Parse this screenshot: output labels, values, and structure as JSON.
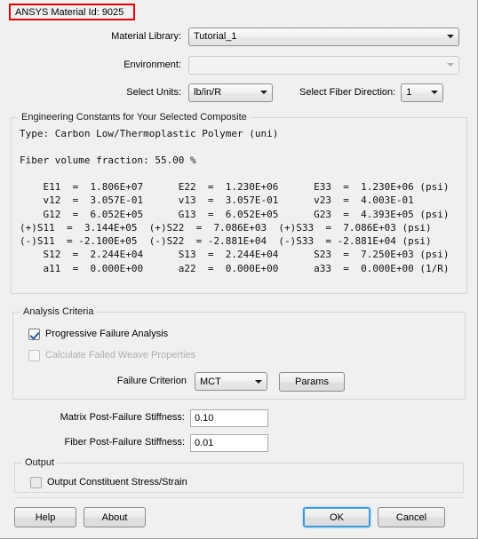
{
  "dialog": {
    "material_id_label": "ANSYS Material Id: 9025",
    "highlight_color": "#e50000"
  },
  "form": {
    "material_library": {
      "label": "Material Library:",
      "value": "Tutorial_1"
    },
    "environment": {
      "label": "Environment:",
      "value": ""
    },
    "select_units": {
      "label": "Select Units:",
      "value": "lb/in/R"
    },
    "select_fiber_direction": {
      "label": "Select Fiber Direction:",
      "value": "1"
    }
  },
  "engineering_constants": {
    "title": "Engineering Constants for Your Selected Composite",
    "type_line": "Type: Carbon Low/Thermoplastic Polymer (uni)",
    "fiber_volume_line": "Fiber volume fraction: 55.00 %",
    "table_text": "    E11  =  1.806E+07      E22  =  1.230E+06      E33  =  1.230E+06 (psi)\n    v12  =  3.057E-01      v13  =  3.057E-01      v23  =  4.003E-01\n    G12  =  6.052E+05      G13  =  6.052E+05      G23  =  4.393E+05 (psi)\n(+)S11  =  3.144E+05  (+)S22  =  7.086E+03  (+)S33  =  7.086E+03 (psi)\n(-)S11  = -2.100E+05  (-)S22  = -2.881E+04  (-)S33  = -2.881E+04 (psi)\n    S12  =  2.244E+04      S13  =  2.244E+04      S23  =  7.250E+03 (psi)\n    a11  =  0.000E+00      a22  =  0.000E+00      a33  =  0.000E+00 (1/R)",
    "rows": [
      {
        "c1_name": "E11",
        "c1_value": "1.806E+07",
        "c2_name": "E22",
        "c2_value": "1.230E+06",
        "c3_name": "E33",
        "c3_value": "1.230E+06",
        "units": "(psi)"
      },
      {
        "c1_name": "v12",
        "c1_value": "3.057E-01",
        "c2_name": "v13",
        "c2_value": "3.057E-01",
        "c3_name": "v23",
        "c3_value": "4.003E-01",
        "units": ""
      },
      {
        "c1_name": "G12",
        "c1_value": "6.052E+05",
        "c2_name": "G13",
        "c2_value": "6.052E+05",
        "c3_name": "G23",
        "c3_value": "4.393E+05",
        "units": "(psi)"
      },
      {
        "c1_name": "(+)S11",
        "c1_value": "3.144E+05",
        "c2_name": "(+)S22",
        "c2_value": "7.086E+03",
        "c3_name": "(+)S33",
        "c3_value": "7.086E+03",
        "units": "(psi)"
      },
      {
        "c1_name": "(-)S11",
        "c1_value": "-2.100E+05",
        "c2_name": "(-)S22",
        "c2_value": "-2.881E+04",
        "c3_name": "(-)S33",
        "c3_value": "-2.881E+04",
        "units": "(psi)"
      },
      {
        "c1_name": "S12",
        "c1_value": "2.244E+04",
        "c2_name": "S13",
        "c2_value": "2.244E+04",
        "c3_name": "S23",
        "c3_value": "7.250E+03",
        "units": "(psi)"
      },
      {
        "c1_name": "a11",
        "c1_value": "0.000E+00",
        "c2_name": "a22",
        "c2_value": "0.000E+00",
        "c3_name": "a33",
        "c3_value": "0.000E+00",
        "units": "(1/R)"
      }
    ]
  },
  "analysis_criteria": {
    "title": "Analysis Criteria",
    "progressive_failure_analysis": {
      "label": "Progressive Failure Analysis",
      "checked": true,
      "enabled": true
    },
    "calculate_failed_weave_properties": {
      "label": "Calculate Failed Weave Properties",
      "checked": false,
      "enabled": false
    },
    "failure_criterion": {
      "label": "Failure Criterion",
      "value": "MCT"
    },
    "params_button": "Params"
  },
  "stiffness": {
    "matrix_label": "Matrix Post-Failure Stiffness:",
    "matrix_value": "0.10",
    "fiber_label": "Fiber Post-Failure Stiffness:",
    "fiber_value": "0.01"
  },
  "output": {
    "title": "Output",
    "constituent_stress_strain": {
      "label": "Output Constituent Stress/Strain",
      "checked": false
    }
  },
  "footer": {
    "help": "Help",
    "about": "About",
    "ok": "OK",
    "cancel": "Cancel"
  }
}
